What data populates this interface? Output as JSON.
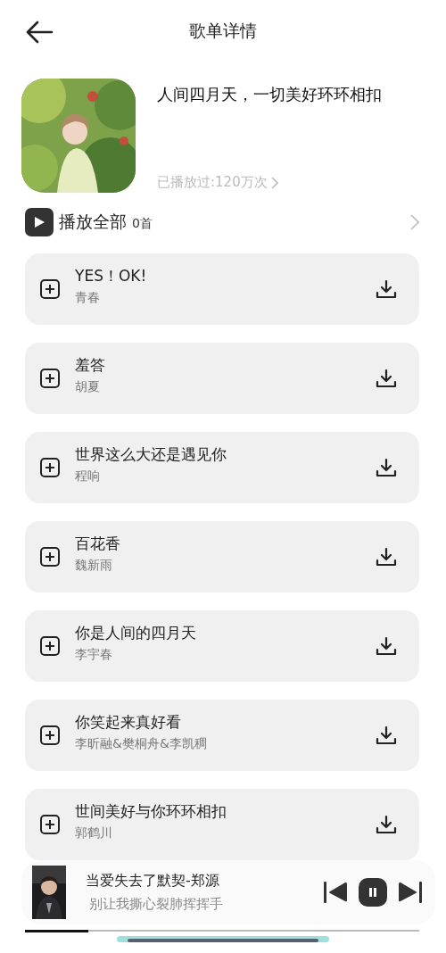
{
  "header": {
    "title": "歌单详情"
  },
  "playlist": {
    "title": "人间四月天，一切美好环环相扣",
    "play_count": "已播放过:120万次"
  },
  "play_all": {
    "label": "播放全部",
    "count": "0首"
  },
  "songs": [
    {
      "title": "YES！OK!",
      "artist": "青春"
    },
    {
      "title": "羞答",
      "artist": "胡夏"
    },
    {
      "title": "世界这么大还是遇见你",
      "artist": "程响"
    },
    {
      "title": "百花香",
      "artist": "魏新雨"
    },
    {
      "title": "你是人间的四月天",
      "artist": "李宇春"
    },
    {
      "title": "你笑起来真好看",
      "artist": "李昕融&樊桐舟&李凯稠"
    },
    {
      "title": "世间美好与你环环相扣",
      "artist": "郭鹤川"
    }
  ],
  "now_playing": {
    "title": "当爱失去了默契-郑源",
    "lyric": "别让我撕心裂肺挥挥手",
    "playing": true,
    "level": 0.16
  }
}
